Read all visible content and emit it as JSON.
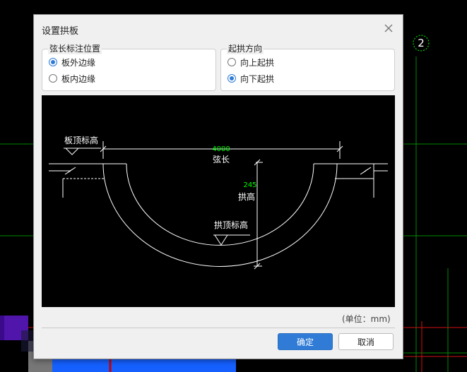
{
  "dialog": {
    "title": "设置拱板",
    "chord_group": {
      "label": "弦长标注位置",
      "options": [
        {
          "label": "板外边缘",
          "checked": true
        },
        {
          "label": "板内边缘",
          "checked": false
        }
      ]
    },
    "direction_group": {
      "label": "起拱方向",
      "options": [
        {
          "label": "向上起拱",
          "checked": false
        },
        {
          "label": "向下起拱",
          "checked": true
        }
      ]
    },
    "preview": {
      "chord_value": "4000",
      "chord_label": "弦长",
      "rise_value": "245",
      "rise_label": "拱高",
      "slab_top_label": "板顶标高",
      "arch_top_label": "拱顶标高"
    },
    "unit_text": "(单位：mm)",
    "ok_label": "确定",
    "cancel_label": "取消"
  },
  "background": {
    "axis_marker": "2"
  },
  "colors": {
    "accent": "#2f7bd6",
    "cad_green": "#00c000",
    "cad_red": "#d01010",
    "dim_green": "#00ff00"
  }
}
